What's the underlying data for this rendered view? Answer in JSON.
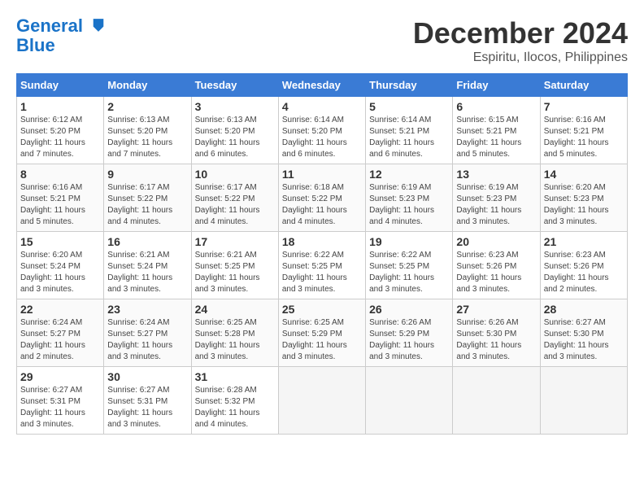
{
  "header": {
    "logo_line1": "General",
    "logo_line2": "Blue",
    "month": "December 2024",
    "location": "Espiritu, Ilocos, Philippines"
  },
  "weekdays": [
    "Sunday",
    "Monday",
    "Tuesday",
    "Wednesday",
    "Thursday",
    "Friday",
    "Saturday"
  ],
  "weeks": [
    [
      {
        "day": "1",
        "sunrise": "Sunrise: 6:12 AM",
        "sunset": "Sunset: 5:20 PM",
        "daylight": "Daylight: 11 hours and 7 minutes."
      },
      {
        "day": "2",
        "sunrise": "Sunrise: 6:13 AM",
        "sunset": "Sunset: 5:20 PM",
        "daylight": "Daylight: 11 hours and 7 minutes."
      },
      {
        "day": "3",
        "sunrise": "Sunrise: 6:13 AM",
        "sunset": "Sunset: 5:20 PM",
        "daylight": "Daylight: 11 hours and 6 minutes."
      },
      {
        "day": "4",
        "sunrise": "Sunrise: 6:14 AM",
        "sunset": "Sunset: 5:20 PM",
        "daylight": "Daylight: 11 hours and 6 minutes."
      },
      {
        "day": "5",
        "sunrise": "Sunrise: 6:14 AM",
        "sunset": "Sunset: 5:21 PM",
        "daylight": "Daylight: 11 hours and 6 minutes."
      },
      {
        "day": "6",
        "sunrise": "Sunrise: 6:15 AM",
        "sunset": "Sunset: 5:21 PM",
        "daylight": "Daylight: 11 hours and 5 minutes."
      },
      {
        "day": "7",
        "sunrise": "Sunrise: 6:16 AM",
        "sunset": "Sunset: 5:21 PM",
        "daylight": "Daylight: 11 hours and 5 minutes."
      }
    ],
    [
      {
        "day": "8",
        "sunrise": "Sunrise: 6:16 AM",
        "sunset": "Sunset: 5:21 PM",
        "daylight": "Daylight: 11 hours and 5 minutes."
      },
      {
        "day": "9",
        "sunrise": "Sunrise: 6:17 AM",
        "sunset": "Sunset: 5:22 PM",
        "daylight": "Daylight: 11 hours and 4 minutes."
      },
      {
        "day": "10",
        "sunrise": "Sunrise: 6:17 AM",
        "sunset": "Sunset: 5:22 PM",
        "daylight": "Daylight: 11 hours and 4 minutes."
      },
      {
        "day": "11",
        "sunrise": "Sunrise: 6:18 AM",
        "sunset": "Sunset: 5:22 PM",
        "daylight": "Daylight: 11 hours and 4 minutes."
      },
      {
        "day": "12",
        "sunrise": "Sunrise: 6:19 AM",
        "sunset": "Sunset: 5:23 PM",
        "daylight": "Daylight: 11 hours and 4 minutes."
      },
      {
        "day": "13",
        "sunrise": "Sunrise: 6:19 AM",
        "sunset": "Sunset: 5:23 PM",
        "daylight": "Daylight: 11 hours and 3 minutes."
      },
      {
        "day": "14",
        "sunrise": "Sunrise: 6:20 AM",
        "sunset": "Sunset: 5:23 PM",
        "daylight": "Daylight: 11 hours and 3 minutes."
      }
    ],
    [
      {
        "day": "15",
        "sunrise": "Sunrise: 6:20 AM",
        "sunset": "Sunset: 5:24 PM",
        "daylight": "Daylight: 11 hours and 3 minutes."
      },
      {
        "day": "16",
        "sunrise": "Sunrise: 6:21 AM",
        "sunset": "Sunset: 5:24 PM",
        "daylight": "Daylight: 11 hours and 3 minutes."
      },
      {
        "day": "17",
        "sunrise": "Sunrise: 6:21 AM",
        "sunset": "Sunset: 5:25 PM",
        "daylight": "Daylight: 11 hours and 3 minutes."
      },
      {
        "day": "18",
        "sunrise": "Sunrise: 6:22 AM",
        "sunset": "Sunset: 5:25 PM",
        "daylight": "Daylight: 11 hours and 3 minutes."
      },
      {
        "day": "19",
        "sunrise": "Sunrise: 6:22 AM",
        "sunset": "Sunset: 5:25 PM",
        "daylight": "Daylight: 11 hours and 3 minutes."
      },
      {
        "day": "20",
        "sunrise": "Sunrise: 6:23 AM",
        "sunset": "Sunset: 5:26 PM",
        "daylight": "Daylight: 11 hours and 3 minutes."
      },
      {
        "day": "21",
        "sunrise": "Sunrise: 6:23 AM",
        "sunset": "Sunset: 5:26 PM",
        "daylight": "Daylight: 11 hours and 2 minutes."
      }
    ],
    [
      {
        "day": "22",
        "sunrise": "Sunrise: 6:24 AM",
        "sunset": "Sunset: 5:27 PM",
        "daylight": "Daylight: 11 hours and 2 minutes."
      },
      {
        "day": "23",
        "sunrise": "Sunrise: 6:24 AM",
        "sunset": "Sunset: 5:27 PM",
        "daylight": "Daylight: 11 hours and 3 minutes."
      },
      {
        "day": "24",
        "sunrise": "Sunrise: 6:25 AM",
        "sunset": "Sunset: 5:28 PM",
        "daylight": "Daylight: 11 hours and 3 minutes."
      },
      {
        "day": "25",
        "sunrise": "Sunrise: 6:25 AM",
        "sunset": "Sunset: 5:29 PM",
        "daylight": "Daylight: 11 hours and 3 minutes."
      },
      {
        "day": "26",
        "sunrise": "Sunrise: 6:26 AM",
        "sunset": "Sunset: 5:29 PM",
        "daylight": "Daylight: 11 hours and 3 minutes."
      },
      {
        "day": "27",
        "sunrise": "Sunrise: 6:26 AM",
        "sunset": "Sunset: 5:30 PM",
        "daylight": "Daylight: 11 hours and 3 minutes."
      },
      {
        "day": "28",
        "sunrise": "Sunrise: 6:27 AM",
        "sunset": "Sunset: 5:30 PM",
        "daylight": "Daylight: 11 hours and 3 minutes."
      }
    ],
    [
      {
        "day": "29",
        "sunrise": "Sunrise: 6:27 AM",
        "sunset": "Sunset: 5:31 PM",
        "daylight": "Daylight: 11 hours and 3 minutes."
      },
      {
        "day": "30",
        "sunrise": "Sunrise: 6:27 AM",
        "sunset": "Sunset: 5:31 PM",
        "daylight": "Daylight: 11 hours and 3 minutes."
      },
      {
        "day": "31",
        "sunrise": "Sunrise: 6:28 AM",
        "sunset": "Sunset: 5:32 PM",
        "daylight": "Daylight: 11 hours and 4 minutes."
      },
      null,
      null,
      null,
      null
    ]
  ]
}
